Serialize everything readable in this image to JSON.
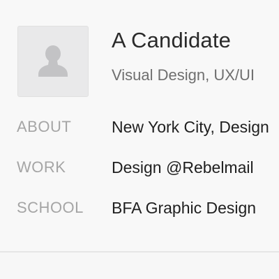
{
  "profile": {
    "avatar_icon": "person-silhouette-icon",
    "name": "A Candidate",
    "headline": "Visual Design, UX/UI"
  },
  "details": {
    "about": {
      "label": "ABOUT",
      "value": "New York City, Design"
    },
    "work": {
      "label": "WORK",
      "value": "Design @Rebelmail"
    },
    "school": {
      "label": "SCHOOL",
      "value": "BFA Graphic Design"
    }
  },
  "colors": {
    "background": "#f8f8f8",
    "avatar_bg": "#e9e9ea",
    "avatar_icon": "#c3c3c5",
    "name": "#2a2a2a",
    "headline": "#6f6f6f",
    "label": "#a5a5a5",
    "value": "#1f1f1f"
  }
}
